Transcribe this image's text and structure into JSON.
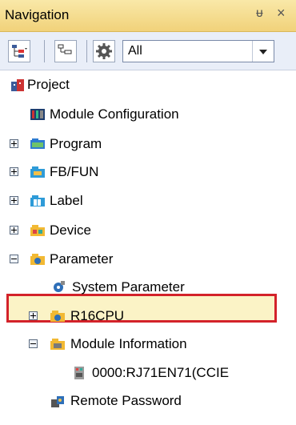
{
  "panel": {
    "title": "Navigation",
    "pin_glyph": "ᵾ",
    "close_glyph": "×"
  },
  "toolbar": {
    "filter_value": "All"
  },
  "tree": {
    "project": "Project",
    "module_configuration": "Module Configuration",
    "program": "Program",
    "fb_fun": "FB/FUN",
    "label": "Label",
    "device": "Device",
    "parameter": "Parameter",
    "system_parameter": "System Parameter",
    "r16cpu": "R16CPU",
    "module_information": "Module Information",
    "module_item": "0000:RJ71EN71(CCIE",
    "remote_password": "Remote Password"
  },
  "colors": {
    "titlebar": "#f1d27a",
    "selection_border": "#d3222a",
    "selection_fill": "#fbf3c6"
  }
}
